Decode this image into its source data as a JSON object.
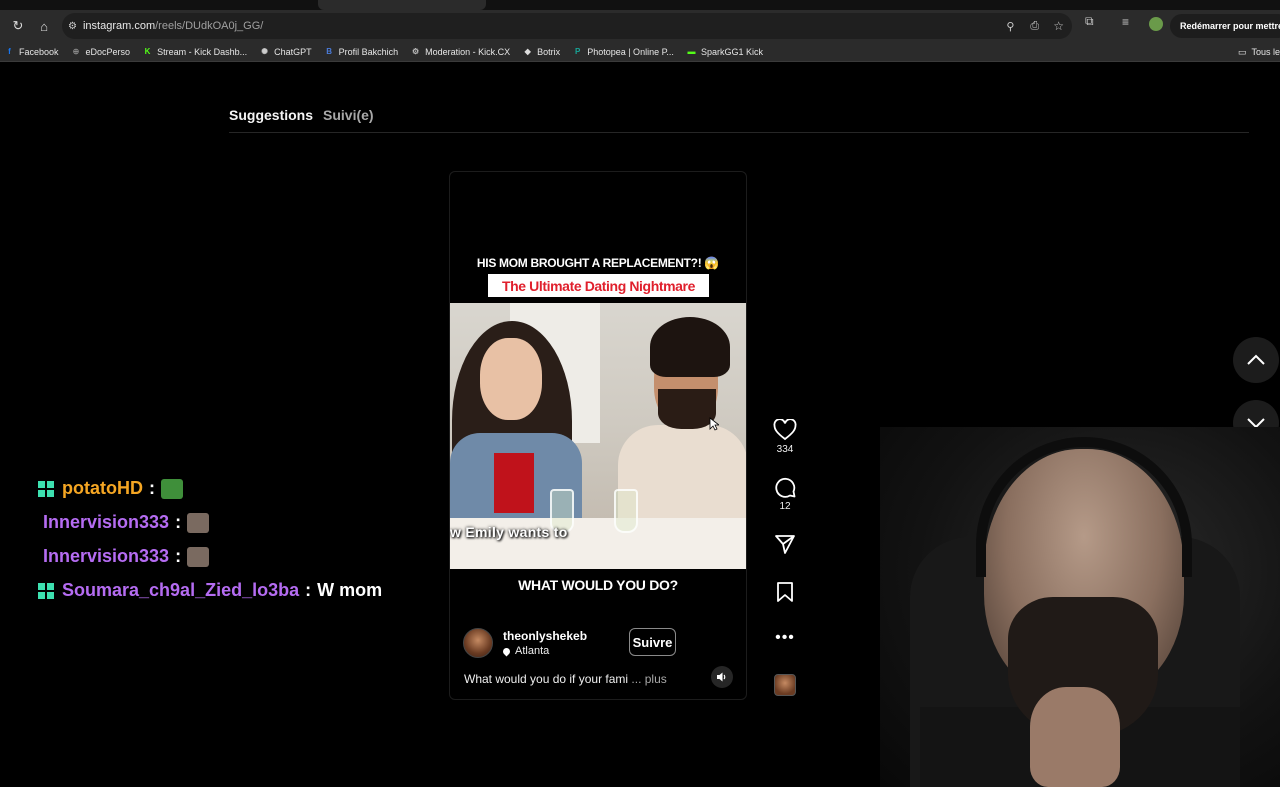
{
  "browser": {
    "url_host": "instagram.com",
    "url_path": "/reels/DUdkOA0j_GG/",
    "restart_label": "Redémarrer pour mettre à",
    "bookmarks": [
      {
        "label": "Facebook",
        "color": "#1877f2",
        "glyph": "f"
      },
      {
        "label": "eDocPerso",
        "color": "#888888",
        "glyph": "⊕"
      },
      {
        "label": "Stream - Kick Dashb...",
        "color": "#53fc18",
        "glyph": "K"
      },
      {
        "label": "ChatGPT",
        "color": "#cccccc",
        "glyph": "✺"
      },
      {
        "label": "Profil Bakchich",
        "color": "#4a7bd8",
        "glyph": "B"
      },
      {
        "label": "Moderation - Kick.CX",
        "color": "#bbbbbb",
        "glyph": "⚙"
      },
      {
        "label": "Botrix",
        "color": "#dddddd",
        "glyph": "◆"
      },
      {
        "label": "Photopea | Online P...",
        "color": "#18a497",
        "glyph": "P"
      },
      {
        "label": "SparkGG1 Kick",
        "color": "#53fc18",
        "glyph": "▬"
      }
    ],
    "bookmarks_right": "Tous le"
  },
  "page": {
    "tab_suggestions": "Suggestions",
    "tab_following": "Suivi(e)"
  },
  "reel": {
    "headline": "HIS MOM BROUGHT A REPLACEMENT?! 😱",
    "subhead": "The Ultimate Dating Nightmare",
    "caption_overlay": "w Emily wants to",
    "question": "WHAT WOULD YOU DO?",
    "author": "theonlyshekeb",
    "location": "Atlanta",
    "follow_label": "Suivre",
    "description": "What would you do if your fami",
    "more": "... plus"
  },
  "actions": {
    "likes": "334",
    "comments": "12"
  },
  "chat": [
    {
      "user": "potatoHD",
      "color": "#f5a623",
      "badge": true,
      "message": "",
      "emote_color": "#3f8f3a"
    },
    {
      "user": "Innervision333",
      "color": "#b56cf2",
      "badge": false,
      "message": "",
      "emote_color": "#7a6a60"
    },
    {
      "user": "Innervision333",
      "color": "#b56cf2",
      "badge": false,
      "message": "",
      "emote_color": "#7a6a60"
    },
    {
      "user": "Soumara_ch9al_Zied_lo3ba",
      "color": "#b56cf2",
      "badge": true,
      "message": "W mom",
      "emote_color": ""
    }
  ]
}
